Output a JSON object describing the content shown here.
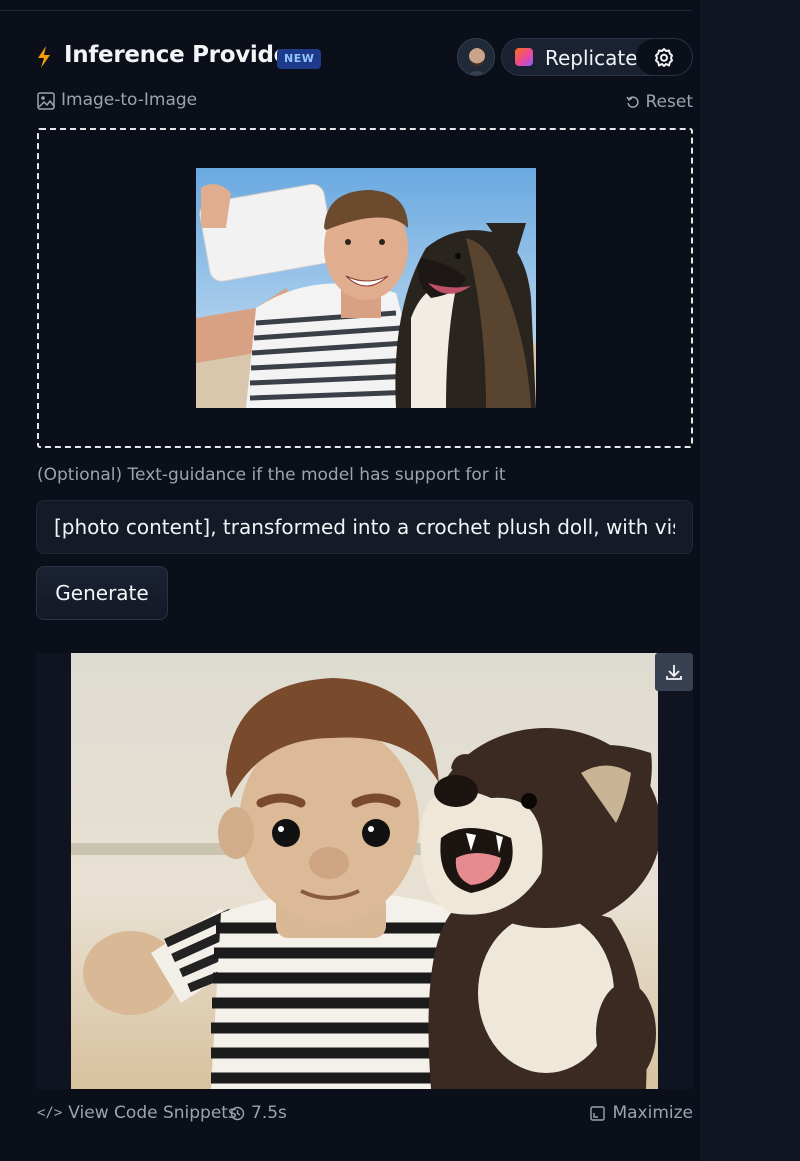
{
  "header": {
    "title": "Inference Providers",
    "badge": "NEW",
    "provider_name": "Replicate",
    "icons": {
      "title": "bolt-icon",
      "settings": "settings-icon"
    }
  },
  "task": {
    "label": "Image-to-Image",
    "reset_label": "Reset"
  },
  "input_image": {
    "description_icon": "image-icon"
  },
  "guidance": {
    "label": "(Optional) Text-guidance if the model has support for it",
    "value": "[photo content], transformed into a crochet plush doll, with visible yarn texture"
  },
  "generate_label": "Generate",
  "output": {
    "download_icon": "download-icon"
  },
  "footer": {
    "snippets_label": "View Code Snippets",
    "timing": "7.5s",
    "maximize_label": "Maximize"
  },
  "colors": {
    "background": "#0b0f19",
    "badge_bg": "#1e3a8a",
    "badge_text": "#93c5fd",
    "bolt": "#f59e0b"
  }
}
